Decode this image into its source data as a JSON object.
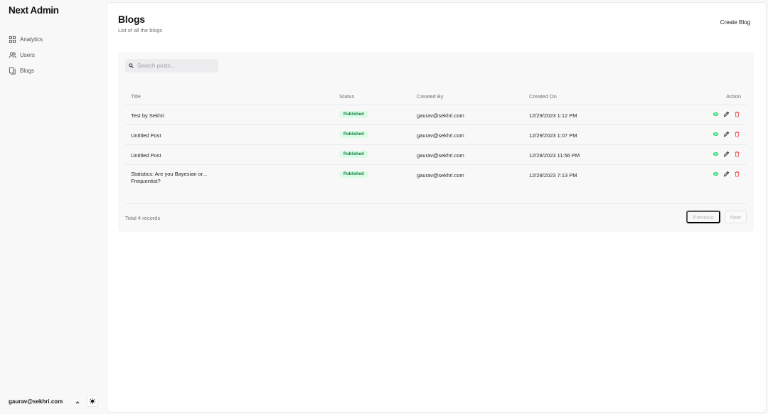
{
  "sidebar": {
    "brand": "Next Admin",
    "items": [
      {
        "label": "Analytics",
        "icon": "grid-icon"
      },
      {
        "label": "Users",
        "icon": "users-icon"
      },
      {
        "label": "Blogs",
        "icon": "documents-icon"
      }
    ],
    "user_email": "gaurav@sekhri.com"
  },
  "header": {
    "title": "Blogs",
    "subtitle": "List of all the blogs",
    "create_label": "Create Blog"
  },
  "search": {
    "placeholder": "Search posts...",
    "value": ""
  },
  "table": {
    "columns": [
      "Title",
      "Status",
      "Created By",
      "Created On",
      "Action"
    ],
    "rows": [
      {
        "title": "Test by Sekhri",
        "status": "Published",
        "created_by": "gaurav@sekhri.com",
        "created_on": "12/29/2023 1:12 PM"
      },
      {
        "title": "Untitled Post",
        "status": "Published",
        "created_by": "gaurav@sekhri.com",
        "created_on": "12/29/2023 1:07 PM"
      },
      {
        "title": "Untitled Post",
        "status": "Published",
        "created_by": "gaurav@sekhri.com",
        "created_on": "12/28/2023 11:56 PM"
      },
      {
        "title": "Statistics: Are you Bayesian or... Frequentist?",
        "status": "Published",
        "created_by": "gaurav@sekhri.com",
        "created_on": "12/28/2023 7:13 PM"
      }
    ]
  },
  "footer": {
    "total": "Total 4 records",
    "previous_label": "Previous",
    "next_label": "Next"
  },
  "colors": {
    "published_bg": "#dcfce7",
    "published_text": "#15803d",
    "view_icon": "#4ade80",
    "delete_icon": "#ef4444"
  }
}
